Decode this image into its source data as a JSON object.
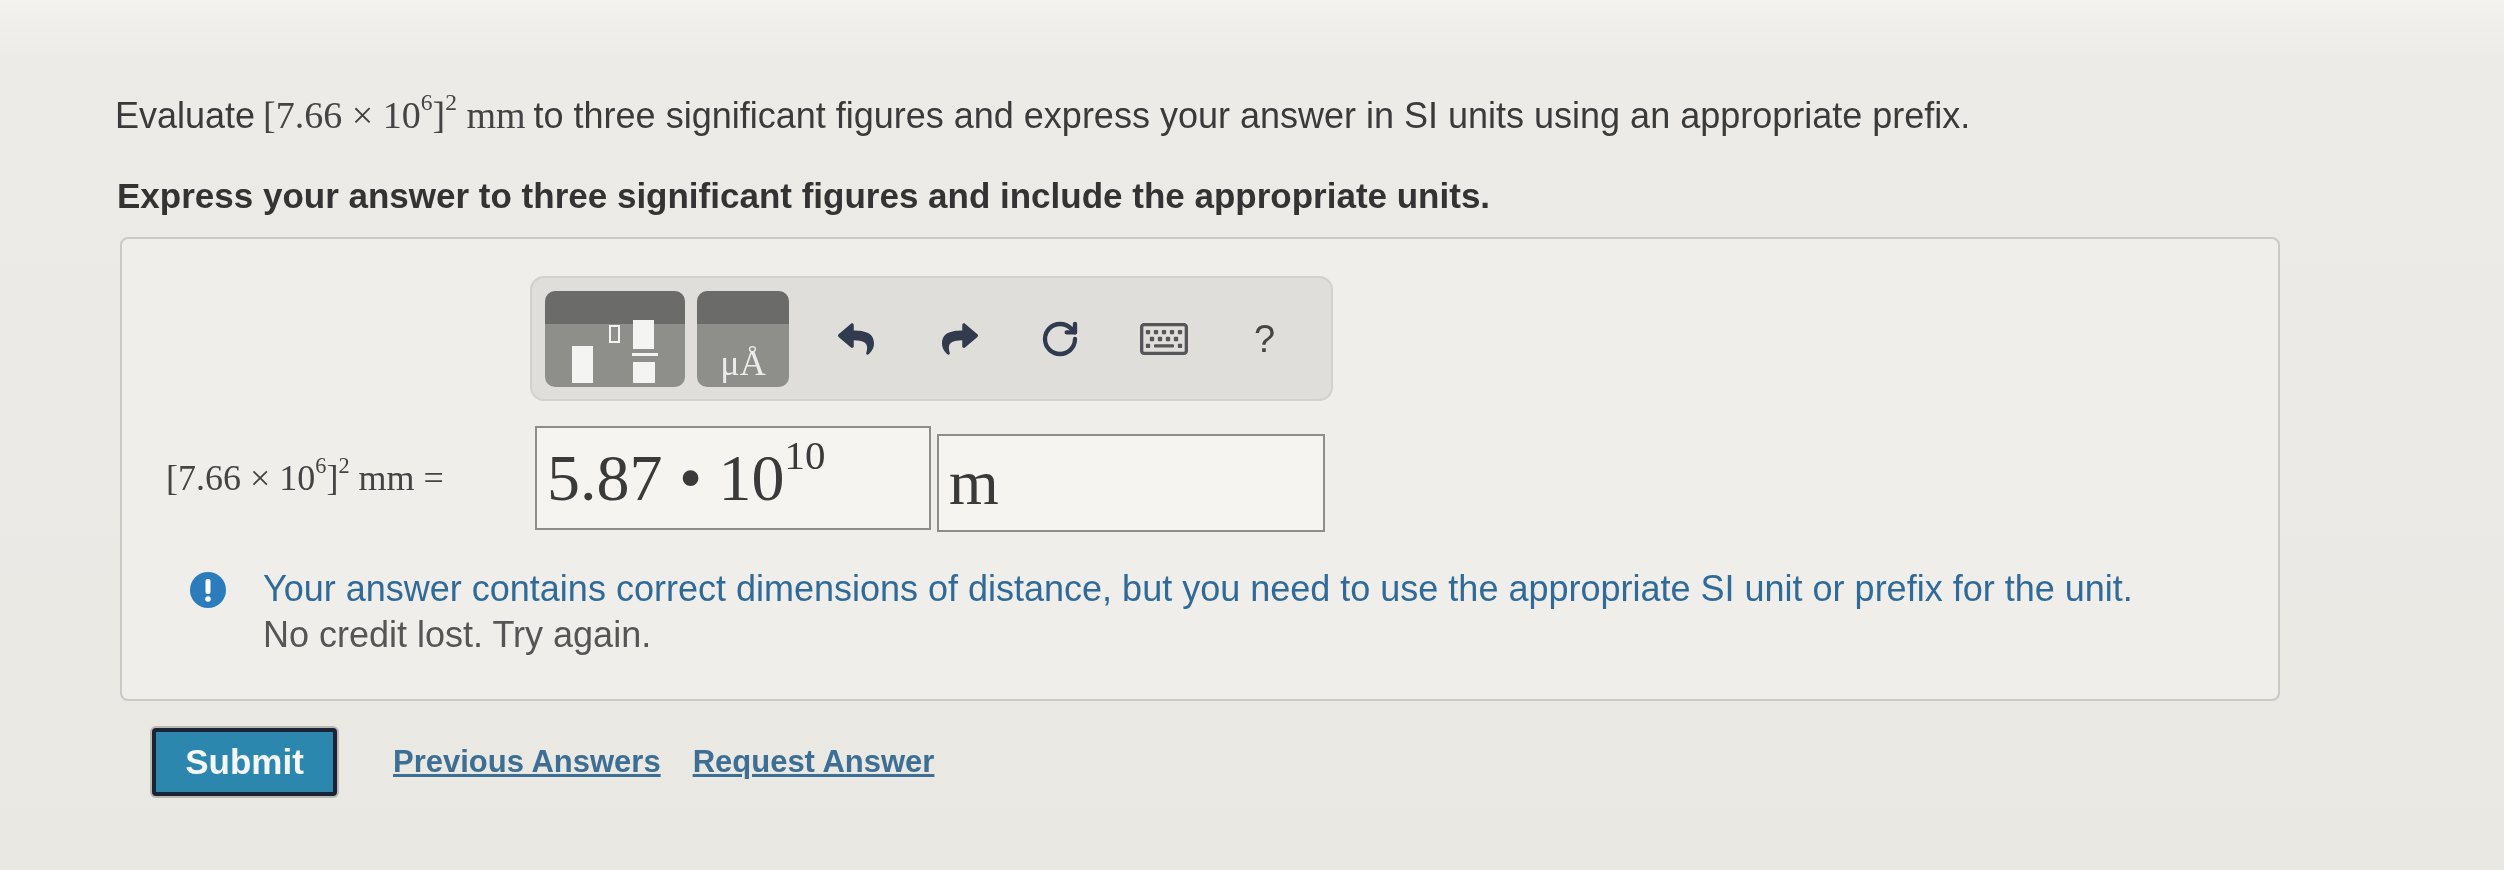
{
  "question": {
    "prompt": {
      "before": "Evaluate",
      "math": "[7.66 × 10$^{6}$]$^{2}$ mm",
      "after": "to three significant figures and express your answer in SI units using an appropriate prefix."
    },
    "instruction": "Express your answer to three significant figures and include the appropriate units."
  },
  "answer_panel": {
    "toolbar": [
      {
        "kind": "templates"
      },
      {
        "kind": "units",
        "label": "μÅ"
      },
      {
        "kind": "undo"
      },
      {
        "kind": "redo"
      },
      {
        "kind": "reset"
      },
      {
        "kind": "keyboard"
      },
      {
        "kind": "help",
        "label": "?"
      }
    ],
    "equation": {
      "label": "[7.66 × 10$^{6}$]$^{2}$ mm =",
      "value": "5.87 • 10$^{10}$",
      "unit": "m"
    },
    "feedback": {
      "message": "Your answer contains correct dimensions of distance, but you need to use the appropriate SI unit or prefix for the unit.",
      "note": "No credit lost. Try again."
    }
  },
  "actions": {
    "submit": "Submit",
    "links": [
      "Previous Answers",
      "Request Answer"
    ]
  }
}
